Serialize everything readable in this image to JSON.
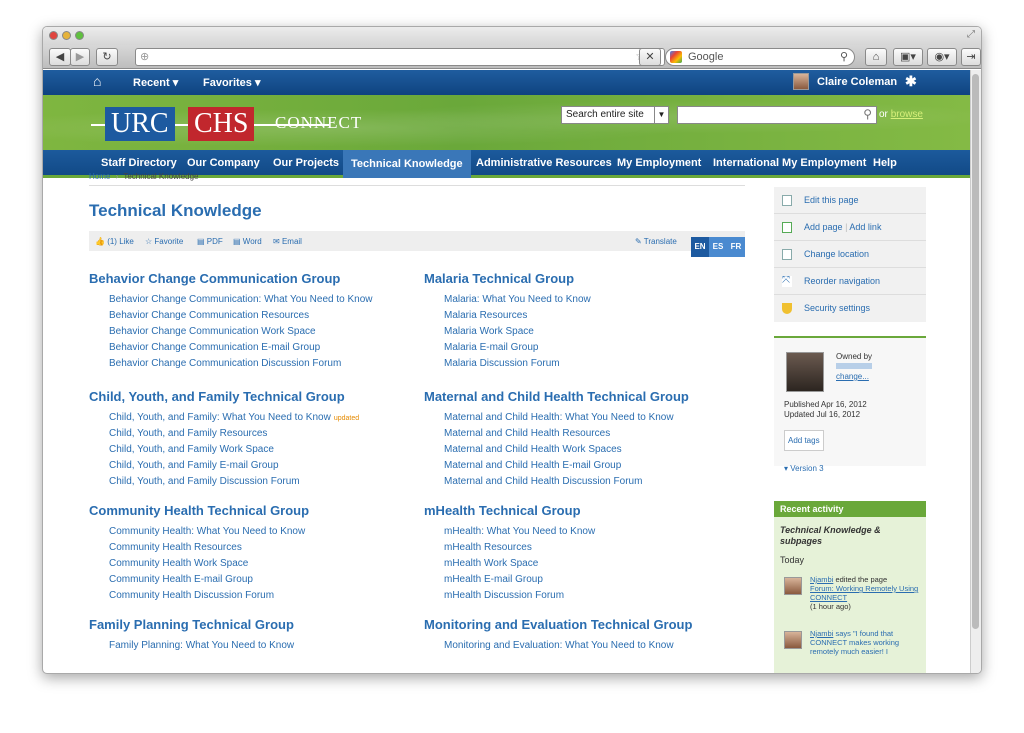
{
  "browser": {
    "search_engine": "Google"
  },
  "topnav": {
    "recent": "Recent",
    "favorites": "Favorites",
    "user": "Claire Coleman"
  },
  "banner": {
    "logo_urc": "URC",
    "logo_chs": "CHS",
    "logo_connect": "CONNECT",
    "search_scope": "Search entire site",
    "or": "or",
    "browse": "browse"
  },
  "menu": [
    "Staff Directory",
    "Our Company",
    "Our Projects",
    "Technical Knowledge",
    "Administrative Resources",
    "My Employment",
    "International My Employment",
    "Help"
  ],
  "breadcrumb": {
    "home": "Home",
    "sep": "›",
    "current": "Technical Knowledge"
  },
  "page_title": "Technical Knowledge",
  "actions": {
    "like": "(1) Like",
    "favorite": "Favorite",
    "pdf": "PDF",
    "word": "Word",
    "email": "Email",
    "translate": "Translate",
    "langs": [
      "EN",
      "ES",
      "FR"
    ]
  },
  "left_groups": [
    {
      "title": "Behavior Change Communication Group",
      "links": [
        "Behavior Change Communication: What You Need to Know",
        "Behavior Change Communication Resources",
        "Behavior Change Communication Work Space",
        "Behavior Change Communication E-mail Group",
        "Behavior Change Communication Discussion Forum"
      ]
    },
    {
      "title": "Child, Youth, and Family Technical Group",
      "links": [
        "Child, Youth, and Family: What You Need to Know",
        "Child, Youth, and Family Resources",
        "Child, Youth, and Family Work Space",
        "Child, Youth, and Family E-mail Group",
        "Child, Youth, and Family Discussion Forum"
      ]
    },
    {
      "title": "Community Health Technical Group",
      "links": [
        "Community Health: What You Need to Know",
        "Community Health Resources",
        "Community Health Work Space",
        "Community Health E-mail Group",
        "Community Health Discussion Forum"
      ]
    },
    {
      "title": "Family Planning Technical Group",
      "links": [
        "Family Planning: What You Need to Know"
      ]
    }
  ],
  "right_groups": [
    {
      "title": "Malaria Technical Group",
      "links": [
        "Malaria: What You Need to Know",
        "Malaria Resources",
        "Malaria Work Space",
        "Malaria E-mail Group",
        "Malaria Discussion Forum"
      ]
    },
    {
      "title": "Maternal and Child Health Technical Group",
      "links": [
        "Maternal and Child Health: What You Need to Know",
        "Maternal and Child Health Resources",
        "Maternal and Child Health Work Spaces",
        "Maternal and Child Health E-mail Group",
        "Maternal and Child Health Discussion Forum"
      ]
    },
    {
      "title": "mHealth Technical Group",
      "links": [
        "mHealth: What You Need to Know",
        "mHealth Resources",
        "mHealth Work Space",
        "mHealth E-mail Group",
        "mHealth Discussion Forum"
      ]
    },
    {
      "title": "Monitoring and Evaluation Technical Group",
      "links": [
        "Monitoring and Evaluation: What You Need to Know"
      ]
    }
  ],
  "updated_badge": "updated",
  "sidebar": {
    "edit": "Edit this page",
    "add_page": "Add page",
    "add_link": "Add link",
    "change_location": "Change location",
    "reorder": "Reorder navigation",
    "security": "Security settings",
    "owned_by": "Owned by",
    "change": "change...",
    "published": "Published Apr 16, 2012",
    "updated": "Updated Jul 16, 2012",
    "add_tags": "Add tags",
    "version": "▾ Version 3"
  },
  "recent": {
    "header": "Recent activity",
    "subtitle": "Technical Knowledge & subpages",
    "today": "Today",
    "a1_user": "Njambi",
    "a1_text": "edited the page",
    "a1_link": "Forum: Working Remotely Using CONNECT",
    "a1_time": "(1 hour ago)",
    "a2_user": "Njambi",
    "a2_text": "says \"I found that CONNECT makes working remotely much easier! I"
  },
  "colors": {
    "blue": "#2a6db0",
    "green": "#6aa83a",
    "navy": "#124a87",
    "red": "#c1272d"
  }
}
